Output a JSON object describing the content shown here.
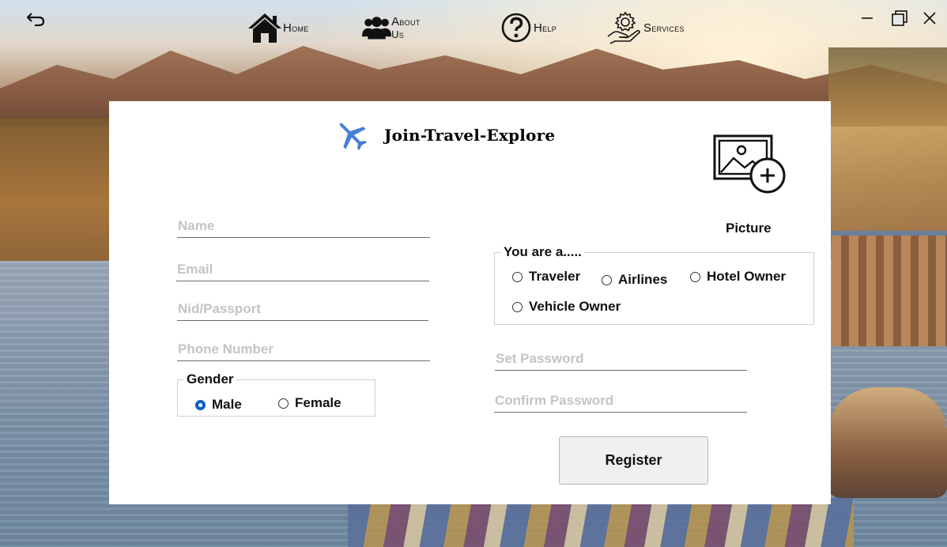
{
  "nav": {
    "home": "Home",
    "about": "About Us",
    "help": "Help",
    "services": "Services"
  },
  "form": {
    "title": "Join-Travel-Explore",
    "picture_label": "Picture",
    "name_placeholder": "Name",
    "email_placeholder": "Email",
    "nid_placeholder": "Nid/Passport",
    "phone_placeholder": "Phone Number",
    "gender": {
      "legend": "Gender",
      "options": [
        "Male",
        "Female"
      ],
      "selected": "Male"
    },
    "role": {
      "legend": "You are a.....",
      "options": [
        "Traveler",
        "Airlines",
        "Hotel Owner",
        "Vehicle Owner"
      ],
      "selected": null
    },
    "password_placeholder": "Set Password",
    "confirm_placeholder": "Confirm Password",
    "register_label": "Register"
  },
  "colors": {
    "radio_selected": "#0a5fc5",
    "plane_icon": "#4a7fd6",
    "panel_bg": "#ffffff"
  }
}
